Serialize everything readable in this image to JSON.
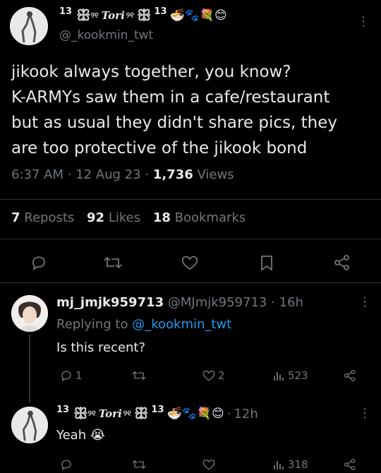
{
  "main_tweet": {
    "display_name": {
      "num_left": "13",
      "deco_text": "Tori",
      "num_right": "13",
      "emoji": "🍜🐾💐😊"
    },
    "handle": "@_kookmin_twt",
    "body_lines": [
      "jikook always together, you know?",
      "K-ARMYs saw them in a cafe/restaurant",
      "but as usual they didn't share pics, they",
      "are too protective of the jikook bond"
    ],
    "meta": {
      "time": "6:37 AM",
      "sep1": "·",
      "date": "12 Aug 23",
      "sep2": "·",
      "views_count": "1,736",
      "views_label": "Views"
    },
    "stats": {
      "reposts_count": "7",
      "reposts_label": "Reposts",
      "likes_count": "92",
      "likes_label": "Likes",
      "bookmarks_count": "18",
      "bookmarks_label": "Bookmarks"
    },
    "more_icon": "⋮"
  },
  "reply1": {
    "display_name": "mj_jmjk959713",
    "handle": "@MJmjk959713",
    "sep": "·",
    "time": "16h",
    "replying_prefix": "Replying to",
    "replying_handle": "@_kookmin_twt",
    "text": "Is this recent?",
    "reply_count": "1",
    "like_count": "2",
    "view_count": "523",
    "more_icon": "⋮"
  },
  "reply2": {
    "display_name": {
      "num_left": "13",
      "deco_text": "Tori",
      "num_right": "13",
      "emoji": "🍜🐾💐😊"
    },
    "sep": "·",
    "time": "12h",
    "text": "Yeah",
    "text_emoji": "😭",
    "view_count": "318",
    "more_icon": "⋮"
  },
  "colors": {
    "background": "#000000",
    "text": "#e7e9ea",
    "secondary": "#71767b",
    "link": "#1d9bf0"
  }
}
